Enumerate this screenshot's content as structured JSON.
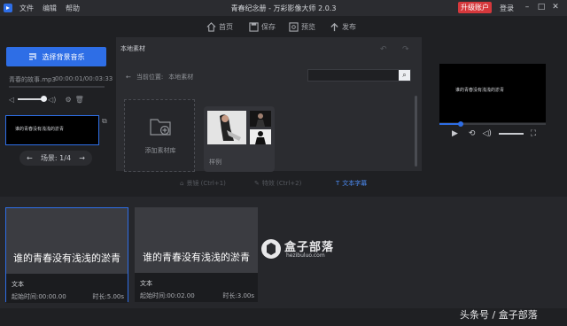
{
  "titlebar": {
    "menu": [
      "文件",
      "编辑",
      "帮助"
    ],
    "title": "青春纪念册 - 万彩影像大师 2.0.3",
    "upgrade": "升级账户",
    "login": "登录"
  },
  "toolbar": {
    "home": "首页",
    "save": "保存",
    "preview": "预览",
    "publish": "发布"
  },
  "left": {
    "music_button": "选择背景音乐",
    "song_name": "青春的故事.mp3",
    "song_time": "00:00:01/00:03:33",
    "scene_text": "谁的青春没有浅浅的淤青",
    "scene_label": "场景: 1/4"
  },
  "material": {
    "tab": "本地素材",
    "location_label": "当前位置:",
    "location_value": "本地素材",
    "search_placeholder": "",
    "add_library": "添加素材库",
    "example_label": "样例"
  },
  "preview": {
    "caption": "谁的青春没有浅浅的淤青",
    "progress": 0.2
  },
  "tabs": {
    "shot": "景镜 (Ctrl+1)",
    "effect": "特效 (Ctrl+2)",
    "subtitle": "文本字幕"
  },
  "timeline": {
    "clips": [
      {
        "text": "谁的青春没有浅浅的淤青",
        "type": "文本",
        "start": "起始时间:00:00.00",
        "duration": "时长:5.00s"
      },
      {
        "text": "谁的青春没有浅浅的淤青",
        "type": "文本",
        "start": "起始时间:00:02.00",
        "duration": "时长:3.00s"
      }
    ]
  },
  "watermark": {
    "name": "盒子部落",
    "url": "hezibuluo.com",
    "bottom": "头条号 / 盒子部落"
  }
}
